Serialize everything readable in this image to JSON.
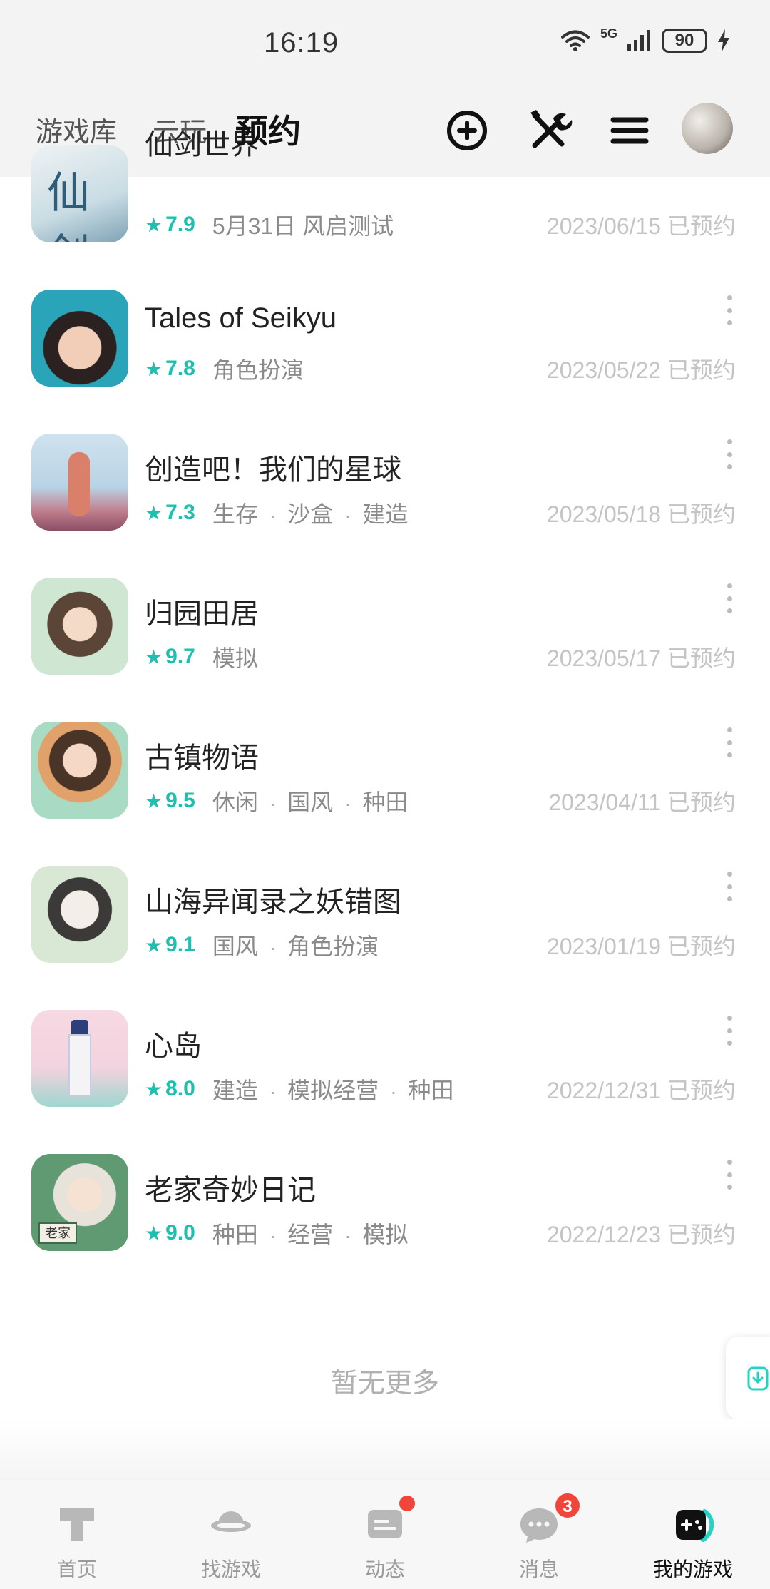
{
  "status_bar": {
    "time": "16:19",
    "network": "5G",
    "battery": "90"
  },
  "header": {
    "tabs": [
      "游戏库",
      "云玩",
      "预约"
    ],
    "icons": [
      "add-circle-icon",
      "tools-icon",
      "menu-icon"
    ]
  },
  "games": [
    {
      "name": "仙剑世界",
      "rating": "7.9",
      "tags": [
        "5月31日 风启测试"
      ],
      "date": "2023/06/15 已预约",
      "icon_colors": [
        "#dfe9ee",
        "#5a8aa8"
      ]
    },
    {
      "name": "Tales of Seikyu",
      "rating": "7.8",
      "tags": [
        "角色扮演"
      ],
      "date": "2023/05/22 已预约",
      "icon_colors": [
        "#2aa4b8",
        "#2b2120"
      ]
    },
    {
      "name": "创造吧！我们的星球",
      "rating": "7.3",
      "tags": [
        "生存",
        "沙盒",
        "建造"
      ],
      "date": "2023/05/18 已预约",
      "icon_colors": [
        "#b9d3e6",
        "#c06d80"
      ]
    },
    {
      "name": "归园田居",
      "rating": "9.7",
      "tags": [
        "模拟"
      ],
      "date": "2023/05/17 已预约",
      "icon_colors": [
        "#cfe6d2",
        "#5b4536"
      ]
    },
    {
      "name": "古镇物语",
      "rating": "9.5",
      "tags": [
        "休闲",
        "国风",
        "种田"
      ],
      "date": "2023/04/11 已预约",
      "icon_colors": [
        "#a9dbc4",
        "#e0a16a"
      ]
    },
    {
      "name": "山海异闻录之妖错图",
      "rating": "9.1",
      "tags": [
        "国风",
        "角色扮演"
      ],
      "date": "2023/01/19 已预约",
      "icon_colors": [
        "#d9e8d5",
        "#3b3a38"
      ]
    },
    {
      "name": "心岛",
      "rating": "8.0",
      "tags": [
        "建造",
        "模拟经营",
        "种田"
      ],
      "date": "2022/12/31 已预约",
      "icon_colors": [
        "#f2d3df",
        "#6fbfc8"
      ]
    },
    {
      "name": "老家奇妙日记",
      "rating": "9.0",
      "tags": [
        "种田",
        "经营",
        "模拟"
      ],
      "date": "2022/12/23 已预约",
      "icon_colors": [
        "#5f9a72",
        "#e8e3da"
      ]
    }
  ],
  "icon_text": {
    "xianjian": "仙剑",
    "laojia": "老家"
  },
  "footer": {
    "no_more": "暂无更多"
  },
  "bottom_nav": [
    {
      "label": "首页",
      "icon": "home-icon"
    },
    {
      "label": "找游戏",
      "icon": "planet-icon"
    },
    {
      "label": "动态",
      "icon": "feed-icon"
    },
    {
      "label": "消息",
      "icon": "message-icon",
      "badge": "3"
    },
    {
      "label": "我的游戏",
      "icon": "gamepad-icon",
      "active": true
    }
  ],
  "colors": {
    "accent": "#25d3c3",
    "rating": "#1fbfb0",
    "badge": "#f2453a"
  }
}
